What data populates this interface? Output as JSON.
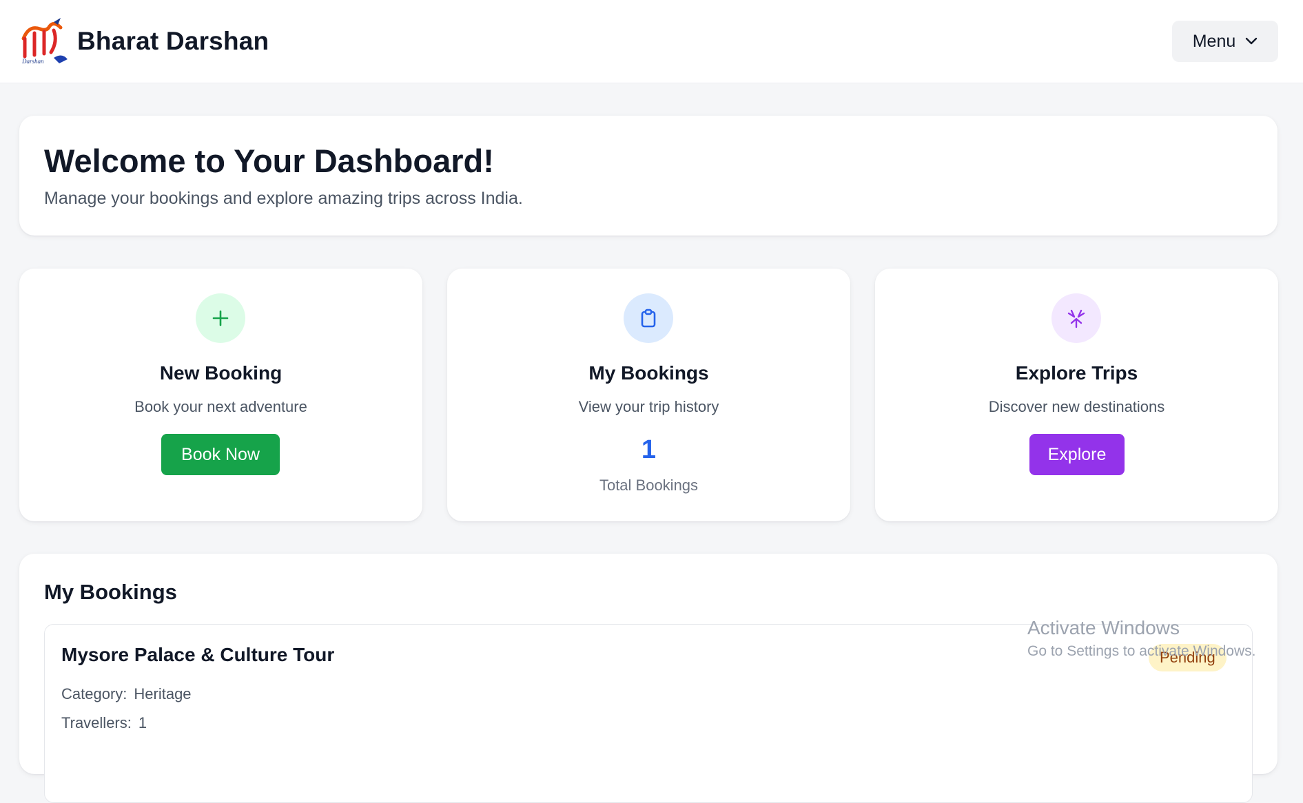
{
  "header": {
    "brand_name": "Bharat Darshan",
    "logo_text": "Darshan",
    "menu_label": "Menu"
  },
  "welcome": {
    "title": "Welcome to Your Dashboard!",
    "subtitle": "Manage your bookings and explore amazing trips across India."
  },
  "actions": [
    {
      "title": "New Booking",
      "subtitle": "Book your next adventure",
      "button_label": "Book Now",
      "icon": "plus-icon",
      "icon_bg": "#dcfce7",
      "icon_color": "#16a34a",
      "button_color": "#16a34a"
    },
    {
      "title": "My Bookings",
      "subtitle": "View your trip history",
      "count": "1",
      "count_label": "Total Bookings",
      "icon": "clipboard-icon",
      "icon_bg": "#dbeafe",
      "icon_color": "#2563eb"
    },
    {
      "title": "Explore Trips",
      "subtitle": "Discover new destinations",
      "button_label": "Explore",
      "icon": "compass-icon",
      "icon_bg": "#f3e8ff",
      "icon_color": "#9333ea",
      "button_color": "#9333ea"
    }
  ],
  "bookings": {
    "title": "My Bookings",
    "items": [
      {
        "name": "Mysore Palace & Culture Tour",
        "status": "Pending",
        "category_label": "Category:",
        "category": "Heritage",
        "travellers_label": "Travellers:",
        "travellers": "1"
      }
    ]
  },
  "watermark": {
    "line1": "Activate Windows",
    "line2": "Go to Settings to activate Windows."
  }
}
